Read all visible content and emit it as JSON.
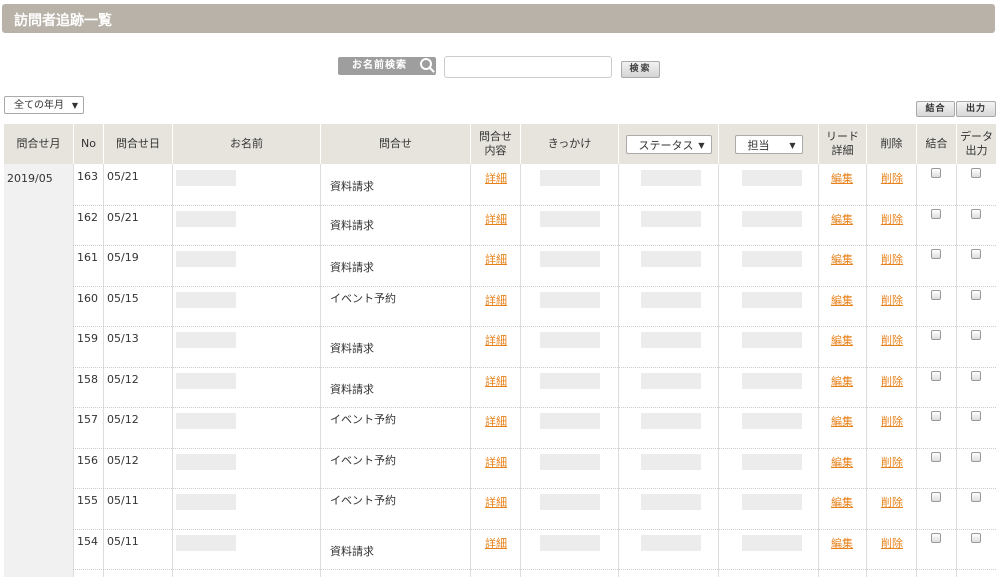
{
  "page": {
    "title": "訪問者追跡一覧"
  },
  "search": {
    "label": "お名前検索",
    "value": "",
    "button_label": "検索"
  },
  "filter": {
    "year_month": "全ての年月"
  },
  "actions": {
    "merge_label": "結合",
    "export_label": "出力"
  },
  "table": {
    "headers": {
      "month": "問合せ月",
      "no": "No",
      "date": "問合せ日",
      "name": "お名前",
      "inquiry": "問合せ",
      "content_line1": "問合せ",
      "content_line2": "内容",
      "trigger": "きっかけ",
      "status": "ステータス",
      "owner": "担当",
      "lead_line1": "リード",
      "lead_line2": "詳細",
      "delete": "削除",
      "merge": "結合",
      "export_line1": "データ",
      "export_line2": "出力"
    },
    "month": "2019/05",
    "detail_link": "詳細",
    "edit_link": "編集",
    "delete_link": "削除",
    "rows": [
      {
        "no": "163",
        "date": "05/21",
        "inquiry": "資料請求"
      },
      {
        "no": "162",
        "date": "05/21",
        "inquiry": "資料請求"
      },
      {
        "no": "161",
        "date": "05/19",
        "inquiry": "資料請求"
      },
      {
        "no": "160",
        "date": "05/15",
        "inquiry": "イベント予約"
      },
      {
        "no": "159",
        "date": "05/13",
        "inquiry": "資料請求"
      },
      {
        "no": "158",
        "date": "05/12",
        "inquiry": "資料請求"
      },
      {
        "no": "157",
        "date": "05/12",
        "inquiry": "イベント予約"
      },
      {
        "no": "156",
        "date": "05/12",
        "inquiry": "イベント予約"
      },
      {
        "no": "155",
        "date": "05/11",
        "inquiry": "イベント予約"
      },
      {
        "no": "154",
        "date": "05/11",
        "inquiry": "資料請求"
      }
    ]
  }
}
